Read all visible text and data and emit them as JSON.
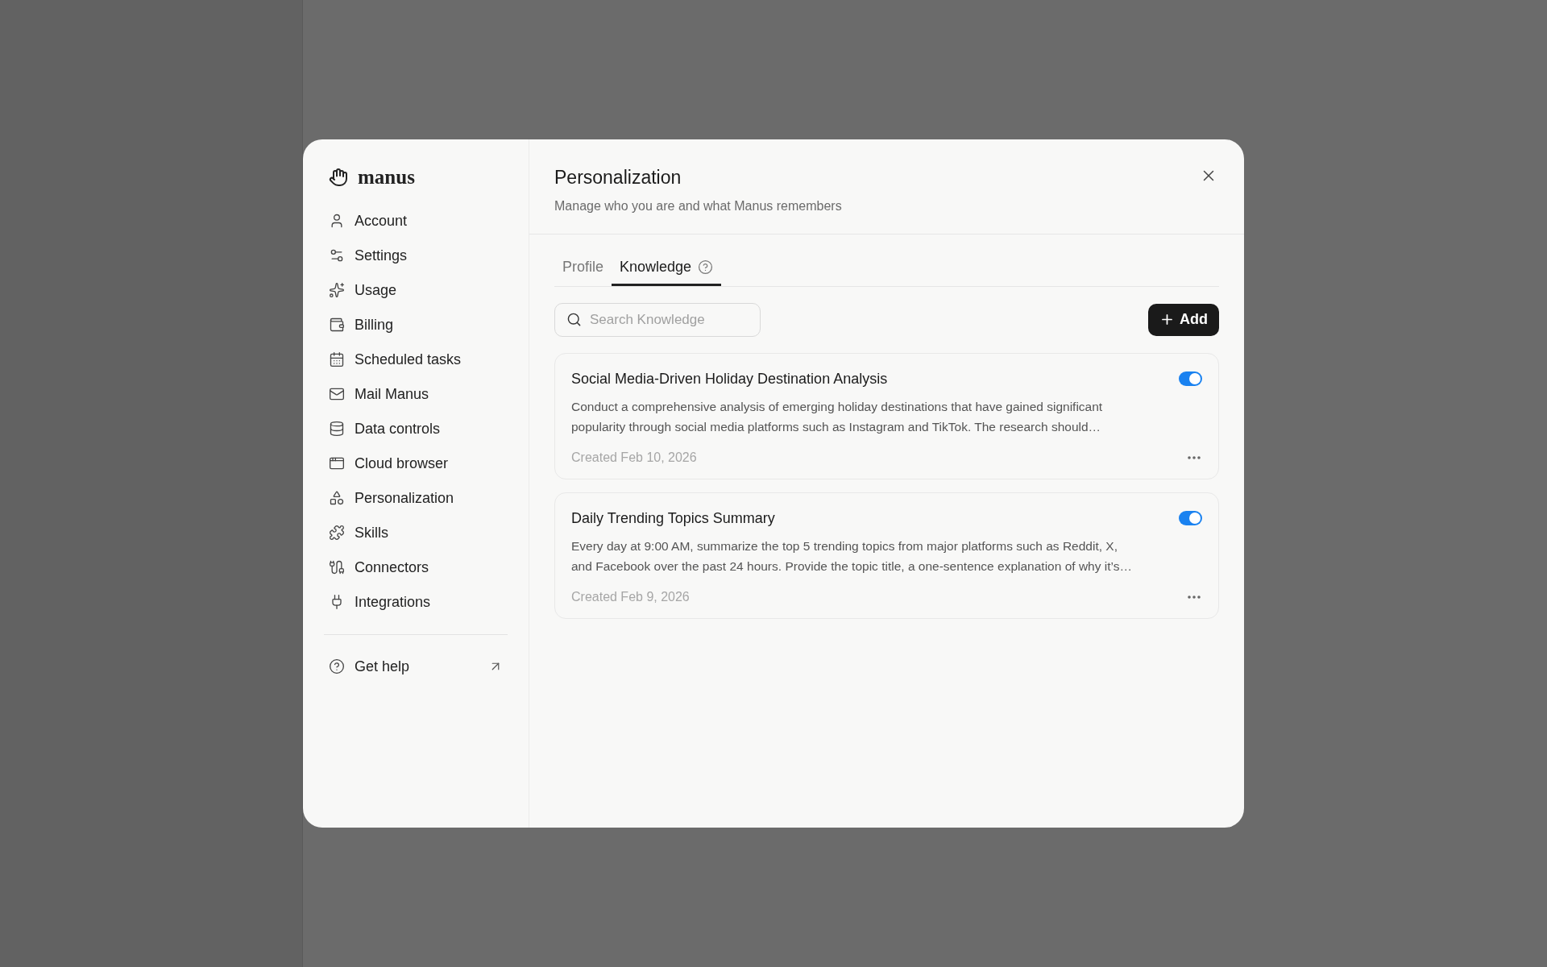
{
  "brand": {
    "name": "manus"
  },
  "nav": {
    "items": [
      {
        "label": "Account"
      },
      {
        "label": "Settings"
      },
      {
        "label": "Usage"
      },
      {
        "label": "Billing"
      },
      {
        "label": "Scheduled tasks"
      },
      {
        "label": "Mail Manus"
      },
      {
        "label": "Data controls"
      },
      {
        "label": "Cloud browser"
      },
      {
        "label": "Personalization"
      },
      {
        "label": "Skills"
      },
      {
        "label": "Connectors"
      },
      {
        "label": "Integrations"
      }
    ],
    "help": {
      "label": "Get help"
    }
  },
  "header": {
    "title": "Personalization",
    "subtitle": "Manage who you are and what Manus remembers"
  },
  "tabs": [
    {
      "label": "Profile",
      "selected": false,
      "help": false
    },
    {
      "label": "Knowledge",
      "selected": true,
      "help": true
    }
  ],
  "search": {
    "placeholder": "Search Knowledge"
  },
  "add_button": {
    "label": "Add"
  },
  "entries": [
    {
      "title": "Social Media-Driven Holiday Destination Analysis",
      "on": true,
      "body": "Conduct a comprehensive analysis of emerging holiday destinations that have gained significant popularity through social media platforms such as Instagram and TikTok. The research should…",
      "created": "Created Feb 10, 2026"
    },
    {
      "title": "Daily Trending Topics Summary",
      "on": true,
      "body": "Every day at 9:00 AM, summarize the top 5 trending topics from major platforms such as Reddit, X, and Facebook over the past 24 hours. Provide the topic title, a one-sentence explanation of why it’s…",
      "created": "Created Feb 9, 2026"
    }
  ]
}
